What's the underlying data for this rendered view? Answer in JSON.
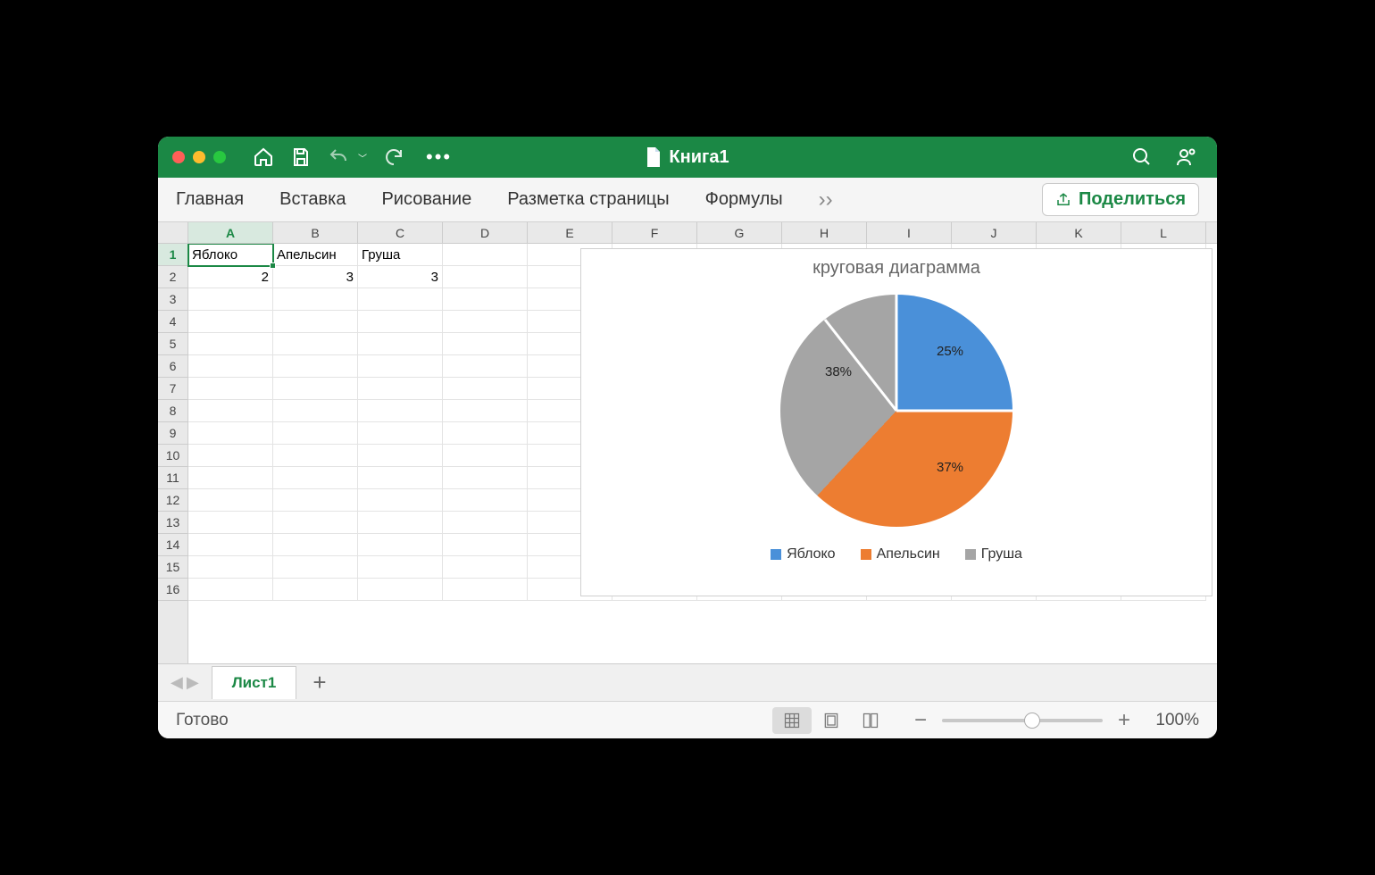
{
  "window": {
    "title": "Книга1"
  },
  "ribbon": {
    "tabs": [
      "Главная",
      "Вставка",
      "Рисование",
      "Разметка страницы",
      "Формулы"
    ],
    "share": "Поделиться"
  },
  "columns": [
    "A",
    "B",
    "C",
    "D",
    "E",
    "F",
    "G",
    "H",
    "I",
    "J",
    "K",
    "L"
  ],
  "rows": [
    "1",
    "2",
    "3",
    "4",
    "5",
    "6",
    "7",
    "8",
    "9",
    "10",
    "11",
    "12",
    "13",
    "14",
    "15",
    "16"
  ],
  "data": {
    "A1": "Яблоко",
    "B1": "Апельсин",
    "C1": "Груша",
    "A2": "2",
    "B2": "3",
    "C2": "3"
  },
  "active_cell": "A1",
  "chart_data": {
    "type": "pie",
    "title": "круговая диаграмма",
    "series": [
      {
        "name": "Яблоко",
        "value": 2,
        "percent": "25%",
        "color": "#4a90d9"
      },
      {
        "name": "Апельсин",
        "value": 3,
        "percent": "37%",
        "color": "#ed7d31"
      },
      {
        "name": "Груша",
        "value": 3,
        "percent": "38%",
        "color": "#a5a5a5"
      }
    ]
  },
  "sheet": {
    "active": "Лист1"
  },
  "status": {
    "text": "Готово",
    "zoom": "100%"
  }
}
